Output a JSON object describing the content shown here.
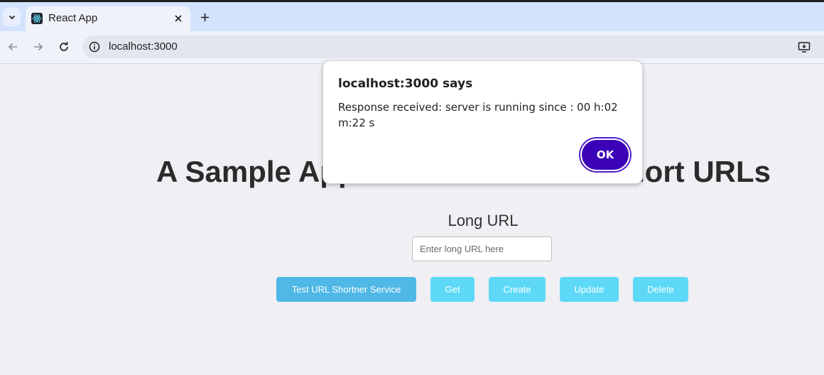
{
  "browser": {
    "tab_title": "React App",
    "url": "localhost:3000"
  },
  "page": {
    "heading": "A Sample Application to Create Short URLs",
    "long_url_label": "Long URL",
    "long_url_placeholder": "Enter long URL here",
    "long_url_value": "",
    "buttons": {
      "test": "Test URL Shortner Service",
      "get": "Get",
      "create": "Create",
      "update": "Update",
      "delete": "Delete"
    }
  },
  "dialog": {
    "title": "localhost:3000 says",
    "message": "Response received:  server is running since : 00 h:02 m:22 s",
    "ok_label": "OK"
  },
  "icons": {
    "tab_search": "chevron-down-icon",
    "favicon": "react-logo-icon",
    "tab_close": "close-icon",
    "new_tab": "plus-icon",
    "back": "arrow-left-icon",
    "forward": "arrow-right-icon",
    "reload": "reload-icon",
    "site_info": "info-icon",
    "install": "install-app-icon"
  },
  "colors": {
    "ok_button": "#3c02b7",
    "primary_button": "#4fb8e6",
    "secondary_button": "#5dd9f7"
  }
}
